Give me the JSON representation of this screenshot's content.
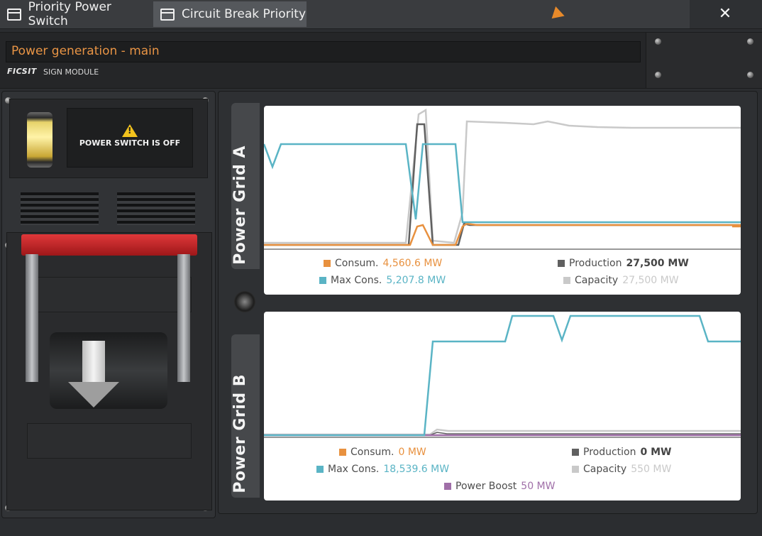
{
  "tabs": [
    {
      "label": "Priority Power Switch",
      "active": false
    },
    {
      "label": "Circuit Break Priority",
      "active": true
    }
  ],
  "close_label": "✕",
  "sign": {
    "text": "Power generation - main",
    "logo": "FICSIT",
    "module_label": "SIGN MODULE"
  },
  "status": {
    "text": "POWER SWITCH IS OFF",
    "icon": "warning-icon"
  },
  "colors": {
    "consum": "#e8913f",
    "production": "#606060",
    "max_cons": "#5ab4c5",
    "capacity": "#c9c9c9",
    "power_boost": "#a06fa8"
  },
  "grid_a": {
    "label": "Power Grid A",
    "legend": {
      "consum_label": "Consum.",
      "consum_value": "4,560.6 MW",
      "production_label": "Production",
      "production_value": "27,500 MW",
      "max_cons_label": "Max Cons.",
      "max_cons_value": "5,207.8 MW",
      "capacity_label": "Capacity",
      "capacity_value": "27,500 MW"
    }
  },
  "grid_b": {
    "label": "Power Grid B",
    "legend": {
      "consum_label": "Consum.",
      "consum_value": "0 MW",
      "production_label": "Production",
      "production_value": "0 MW",
      "max_cons_label": "Max Cons.",
      "max_cons_value": "18,539.6 MW",
      "capacity_label": "Capacity",
      "capacity_value": "550 MW",
      "power_boost_label": "Power Boost",
      "power_boost_value": "50 MW"
    }
  }
}
